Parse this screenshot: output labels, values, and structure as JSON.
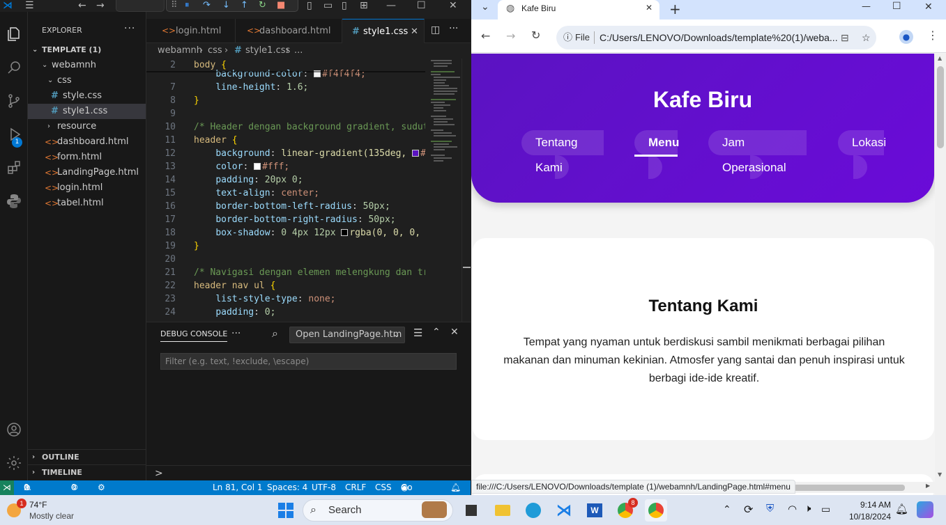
{
  "vscode": {
    "nav_back": "←",
    "nav_forward": "→",
    "debug_toolbar": {
      "pause": "⏸",
      "step_over": "↷",
      "step_into": "↓",
      "step_out": "↑",
      "restart": "↻",
      "stop": "■"
    },
    "explorer": {
      "title": "EXPLORER",
      "root": "TEMPLATE (1)",
      "tree": [
        {
          "label": "webamnh",
          "kind": "folder"
        },
        {
          "label": "css",
          "kind": "folder"
        },
        {
          "label": "style.css",
          "kind": "css"
        },
        {
          "label": "style1.css",
          "kind": "css",
          "selected": true
        },
        {
          "label": "resource",
          "kind": "folder-collapsed"
        },
        {
          "label": "dashboard.html",
          "kind": "html"
        },
        {
          "label": "form.html",
          "kind": "html"
        },
        {
          "label": "LandingPage.html",
          "kind": "html"
        },
        {
          "label": "login.html",
          "kind": "html"
        },
        {
          "label": "tabel.html",
          "kind": "html"
        }
      ],
      "outline": "OUTLINE",
      "timeline": "TIMELINE"
    },
    "activity_badge": "1",
    "tabs": [
      {
        "label": "login.html",
        "icon": "<>"
      },
      {
        "label": "dashboard.html",
        "icon": "<>"
      },
      {
        "label": "style1.css",
        "icon": "#",
        "active": true
      }
    ],
    "breadcrumb": [
      "webamnh",
      "css",
      "style1.css",
      "..."
    ],
    "code_lines": [
      {
        "n": "2",
        "sel": "body",
        "brace": "{"
      },
      {
        "n": "",
        "prop": "background-color",
        "swatch": "#f4f4f4",
        "val": "#f4f4f4;"
      },
      {
        "n": "7",
        "prop": "line-height",
        "num": "1.6;"
      },
      {
        "n": "8",
        "closebrace": "}"
      },
      {
        "n": "9"
      },
      {
        "n": "10",
        "comment": "/* Header dengan background gradient, sudut"
      },
      {
        "n": "11",
        "sel": "header",
        "brace": "{"
      },
      {
        "n": "12",
        "prop": "background",
        "fn": "linear-gradient(135deg, ",
        "swatch": "#5b13c2",
        "val": "#"
      },
      {
        "n": "13",
        "prop": "color",
        "swatch": "#ffffff",
        "val": "#fff;"
      },
      {
        "n": "14",
        "prop": "padding",
        "num": "20px 0;"
      },
      {
        "n": "15",
        "prop": "text-align",
        "val": "center;"
      },
      {
        "n": "16",
        "prop": "border-bottom-left-radius",
        "num": "50px;"
      },
      {
        "n": "17",
        "prop": "border-bottom-right-radius",
        "num": "50px;"
      },
      {
        "n": "18",
        "prop": "box-shadow",
        "num": "0 4px 12px ",
        "swatch": "#000000",
        "fn": "rgba(0, 0, 0,"
      },
      {
        "n": "19",
        "closebrace": "}"
      },
      {
        "n": "20"
      },
      {
        "n": "21",
        "comment": "/* Navigasi dengan elemen melengkung dan tr"
      },
      {
        "n": "22",
        "sel": "header nav ul",
        "brace": "{"
      },
      {
        "n": "23",
        "prop": "list-style-type",
        "val": "none;"
      },
      {
        "n": "24",
        "prop": "padding",
        "num": "0;"
      }
    ],
    "panel": {
      "title": "DEBUG CONSOLE",
      "more": "···",
      "launch_config": "Open LandingPage.htm",
      "filter_placeholder": "Filter (e.g. text, !exclude, \\escape)",
      "prompt": ">"
    },
    "status": {
      "errors": "0",
      "warnings": "0",
      "ports": "0",
      "position": "Ln 81, Col 1",
      "spaces": "Spaces: 4",
      "encoding": "UTF-8",
      "eol": "CRLF",
      "language": "CSS",
      "golive": "Go Live"
    }
  },
  "browser": {
    "tab_title": "Kafe Biru",
    "new_tab": "+",
    "window_min": "—",
    "window_max": "☐",
    "window_close": "✕",
    "file_chip": "File",
    "url": "C:/Users/LENOVO/Downloads/template%20(1)/weba...",
    "status_url": "file:///C:/Users/LENOVO/Downloads/template (1)/webamnh/LandingPage.html#menu",
    "page": {
      "title": "Kafe Biru",
      "nav": [
        "Tentang Kami",
        "Menu",
        "Jam Operasional",
        "Lokasi"
      ],
      "nav_active": "Menu",
      "about_title": "Tentang Kami",
      "about_text": "Tempat yang nyaman untuk berdiskusi sambil menikmati berbagai pilihan makanan dan minuman kekinian. Atmosfer yang santai dan penuh inspirasi untuk berbagi ide-ide kreatif.",
      "header_gradient": [
        "#5b13c2",
        "#6a0bd8"
      ]
    }
  },
  "taskbar": {
    "weather_temp": "74°F",
    "weather_desc": "Mostly clear",
    "weather_badge": "1",
    "search": "Search",
    "chrome_badge": "8",
    "time": "9:14 AM",
    "date": "10/18/2024"
  }
}
